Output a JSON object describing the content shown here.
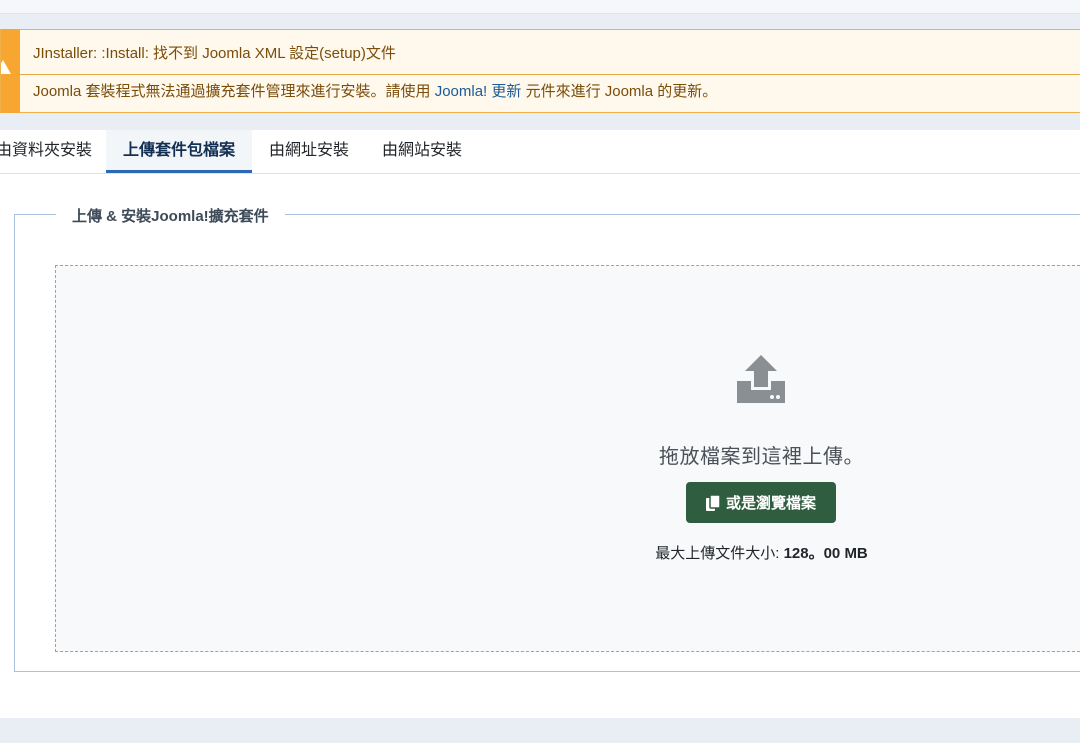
{
  "alert": {
    "title": "JInstaller: :Install: 找不到 Joomla XML 設定(setup)文件",
    "message_before": "Joomla 套裝程式無法通過擴充套件管理來進行安裝。請使用 ",
    "message_link": "Joomla! 更新",
    "message_after": " 元件來進行 Joomla 的更新。",
    "icon": "warning-icon"
  },
  "tabs": [
    {
      "label": "由資料夾安裝",
      "active": false
    },
    {
      "label": "上傳套件包檔案",
      "active": true
    },
    {
      "label": "由網址安裝",
      "active": false
    },
    {
      "label": "由網站安裝",
      "active": false
    }
  ],
  "upload": {
    "legend": "上傳 & 安裝Joomla!擴充套件",
    "drop_text": "拖放檔案到這裡上傳。",
    "browse_label": "或是瀏覽檔案",
    "max_size_label": "最大上傳文件大小: ",
    "max_size_value": "128。00 MB",
    "icon": "upload-icon",
    "button_icon": "copy-icon"
  },
  "colors": {
    "alert_accent": "#f7a631",
    "alert_text": "#7a4d0a",
    "link": "#1b5a96",
    "tab_active_border": "#2a69b8",
    "button_bg": "#2f5d3f"
  }
}
